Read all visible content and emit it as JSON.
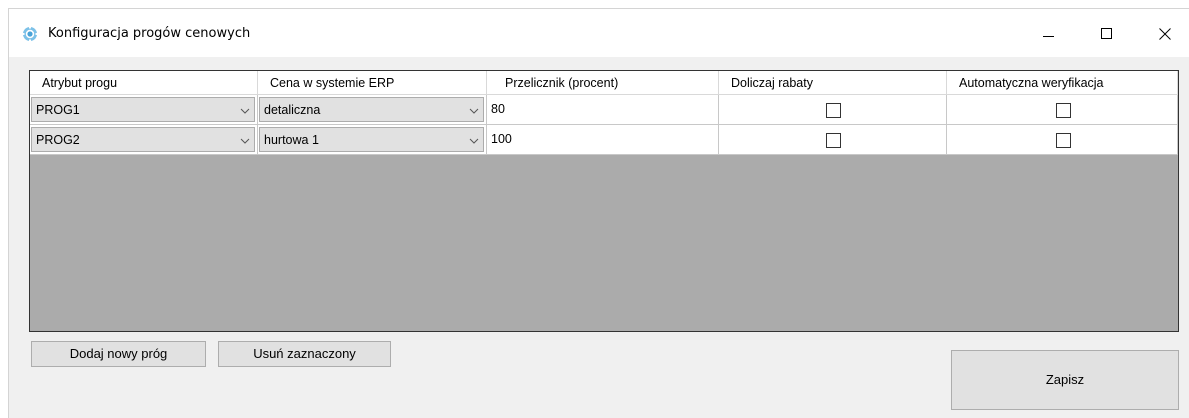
{
  "window": {
    "title": "Konfiguracja progów cenowych",
    "app_icon": "gear-icon",
    "controls": [
      "minimize-icon",
      "maximize-icon",
      "close-icon"
    ]
  },
  "grid": {
    "columns": [
      "Atrybut progu",
      "Cena w systemie ERP",
      "Przelicznik (procent)",
      "Doliczaj rabaty",
      "Automatyczna weryfikacja"
    ],
    "rows": [
      {
        "attribute": "PROG1",
        "erp_price": "detaliczna",
        "multiplier": "80",
        "include_discounts": false,
        "auto_verify": false
      },
      {
        "attribute": "PROG2",
        "erp_price": "hurtowa 1",
        "multiplier": "100",
        "include_discounts": false,
        "auto_verify": false
      }
    ]
  },
  "buttons": {
    "add": "Dodaj nowy próg",
    "delete": "Usuń zaznaczony",
    "save": "Zapisz"
  }
}
